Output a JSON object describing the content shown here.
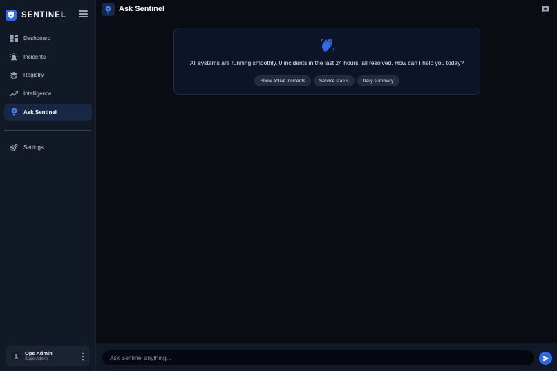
{
  "brand": {
    "name": "SENTINEL"
  },
  "sidebar": {
    "items": [
      {
        "label": "Dashboard",
        "icon": "dashboard-icon"
      },
      {
        "label": "Incidents",
        "icon": "alarm-icon"
      },
      {
        "label": "Registry",
        "icon": "layers-icon"
      },
      {
        "label": "Intelligence",
        "icon": "trend-icon"
      },
      {
        "label": "Ask Sentinel",
        "icon": "bulb-icon",
        "active": true
      }
    ],
    "settings": {
      "label": "Settings",
      "icon": "gear-icon"
    }
  },
  "user": {
    "name": "Ops Admin",
    "role": "SuperAdmin"
  },
  "header": {
    "title": "Ask Sentinel"
  },
  "welcome": {
    "message": "All systems are running smoothly. 0 incidents in the last 24 hours, all resolved. How can I help you today?",
    "suggestions": [
      "Show active incidents",
      "Service status",
      "Daily summary"
    ]
  },
  "composer": {
    "placeholder": "Ask Sentinel anything..."
  },
  "colors": {
    "accent": "#2f6dea",
    "sidebar_bg": "#111826",
    "page_bg": "#090c13",
    "active_item": "#172744"
  }
}
